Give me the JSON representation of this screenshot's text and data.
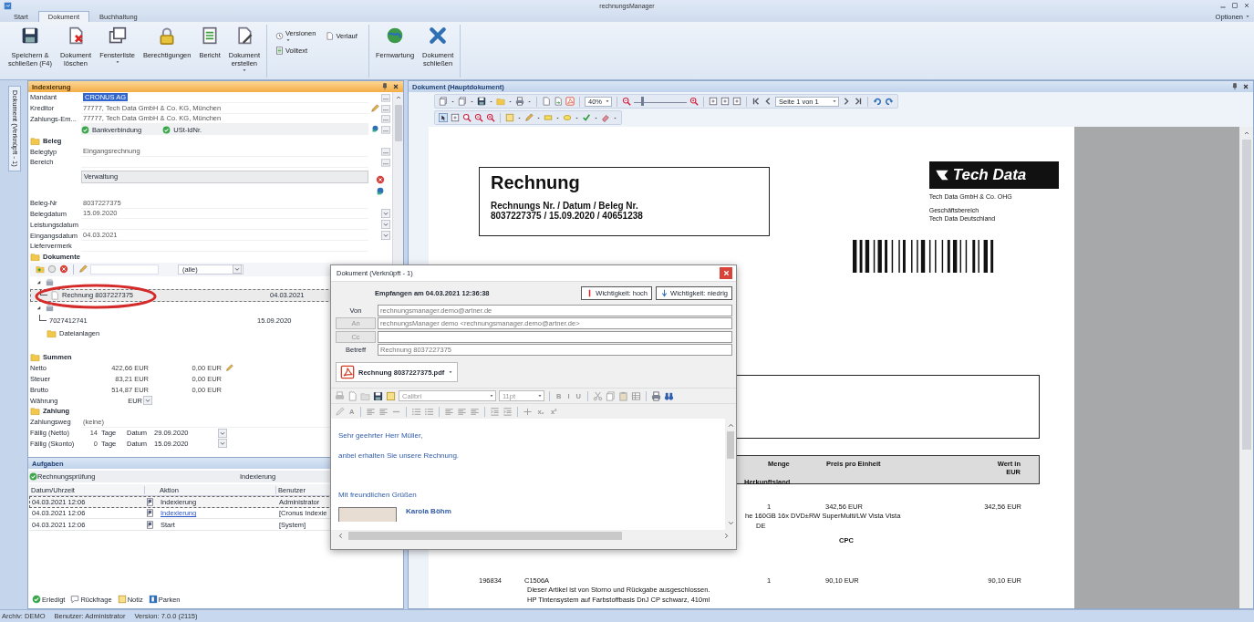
{
  "window": {
    "title": "rechnungsManager"
  },
  "ribbon_tabs": [
    {
      "label": "Start",
      "selected": false
    },
    {
      "label": "Dokument",
      "selected": true
    },
    {
      "label": "Buchhaltung",
      "selected": false
    }
  ],
  "options_menu": {
    "label": "Optionen"
  },
  "ribbon": {
    "groups": [
      {
        "kind": "large",
        "buttons": [
          {
            "label": "Speichern &\nschließen (F4)",
            "dropdown": false
          },
          {
            "label": "Dokument\nlöschen",
            "dropdown": false
          },
          {
            "label": "Fensterliste",
            "dropdown": true
          },
          {
            "label": "Berechtigungen",
            "dropdown": false
          },
          {
            "label": "Bericht",
            "dropdown": false
          },
          {
            "label": "Dokument\nerstellen",
            "dropdown": true
          }
        ]
      },
      {
        "kind": "small",
        "buttons": [
          {
            "label": "Versionen",
            "dropdown": true
          },
          {
            "label": "Verlauf",
            "dropdown": false
          },
          {
            "label": "Volltext",
            "dropdown": false
          }
        ]
      },
      {
        "kind": "large",
        "buttons": [
          {
            "label": "Fernwartung",
            "dropdown": false
          },
          {
            "label": "Dokument\nschließen",
            "dropdown": false
          }
        ]
      }
    ]
  },
  "side_tab": {
    "label": "Dokument (Verknüpft - 1)"
  },
  "indexing": {
    "title": "Indexierung",
    "fields": [
      {
        "kind": "lookup",
        "label": "Mandant",
        "value": "CRONUS AG",
        "highlighted": true
      },
      {
        "kind": "lookup-edit",
        "label": "Kreditor",
        "value": "77777, Tech Data GmbH & Co. KG, München",
        "highlighted": false
      },
      {
        "kind": "lookup",
        "label": "Zahlungs-Em...",
        "value": "77777, Tech Data GmbH & Co. KG, München",
        "highlighted": false
      },
      {
        "kind": "checks",
        "items": [
          {
            "label": "Bankverbindung",
            "checked": true
          },
          {
            "label": "USt-IdNr.",
            "checked": true
          }
        ]
      },
      {
        "kind": "section",
        "label": "Beleg"
      },
      {
        "kind": "lookup",
        "label": "Belegtyp",
        "value": "Eingangsrechnung",
        "highlighted": false
      },
      {
        "kind": "lookup",
        "label": "Bereich",
        "highlighted": false
      },
      {
        "kind": "list",
        "value": "Verwaltung"
      },
      {
        "kind": "text",
        "label": "Beleg-Nr",
        "value": "8037227375",
        "highlighted": false
      },
      {
        "kind": "date",
        "label": "Belegdatum",
        "value": "15.09.2020",
        "highlighted": false
      },
      {
        "kind": "date",
        "label": "Leistungsdatum",
        "highlighted": false
      },
      {
        "kind": "date",
        "label": "Eingangsdatum",
        "value": "04.03.2021",
        "highlighted": false
      },
      {
        "kind": "text",
        "label": "Liefervermerk",
        "highlighted": false
      },
      {
        "kind": "section",
        "label": "Dokumente"
      }
    ],
    "documents": {
      "filter": "(alle)",
      "tree": [
        {
          "kind": "group",
          "expanded": true,
          "children": [
            {
              "kind": "document",
              "label": "Rechnung 8037227375",
              "date": "04.03.2021",
              "selected": true,
              "circled": true
            }
          ]
        },
        {
          "kind": "group",
          "expanded": true,
          "children": [
            {
              "kind": "number",
              "label": "7027412741",
              "date": "15.09.2020",
              "selected": false,
              "circled": false
            }
          ]
        },
        {
          "kind": "folder",
          "label": "Dateianlagen"
        }
      ]
    },
    "sums": {
      "title": "Summen",
      "rows": [
        {
          "kind": "editable",
          "label": "Netto",
          "value": "422,66 EUR",
          "value_2": "0,00 EUR"
        },
        {
          "kind": "plain",
          "label": "Steuer",
          "value": "83,21 EUR",
          "value_2": "0,00 EUR"
        },
        {
          "kind": "plain",
          "label": "Brutto",
          "value": "514,87 EUR",
          "value_2": "0,00 EUR"
        }
      ],
      "currency": {
        "label": "Währung",
        "value": "EUR"
      }
    },
    "payment": {
      "title": "Zahlung",
      "method": {
        "label": "Zahlungsweg",
        "value": "(keine)"
      },
      "due": [
        {
          "label": "Fällig (Netto)",
          "days": "14",
          "unit": "Tage",
          "date_label": "Datum",
          "date": "29.09.2020"
        },
        {
          "label": "Fällig (Skonto)",
          "days": "0",
          "unit": "Tage",
          "date_label": "Datum",
          "date": "15.09.2020"
        }
      ]
    }
  },
  "tasks": {
    "title": "Aufgaben",
    "task": {
      "label": "Rechnungsprüfung",
      "step": "Indexierung"
    },
    "columns": [
      "Datum/Uhrzeit",
      "Aktion",
      "Benutzer"
    ],
    "rows": [
      {
        "time": "04.03.2021 12:06",
        "action": "Indexierung",
        "user": "Administrator",
        "selected": true,
        "link": false
      },
      {
        "time": "04.03.2021 12:06",
        "action": "Indexierung",
        "user": "[Cronus Indexie",
        "selected": false,
        "link": true
      },
      {
        "time": "04.03.2021 12:06",
        "action": "Start",
        "user": "[System]",
        "selected": false,
        "link": false
      }
    ],
    "buttons": [
      "Erledigt",
      "Rückfrage",
      "Notiz",
      "Parken"
    ]
  },
  "document_panel": {
    "title": "Dokument (Hauptdokument)",
    "zoom": "40%",
    "zoom_slider": {
      "level": 0.15
    },
    "page_field": "Seite 1 von 1",
    "page": {
      "heading": "Rechnung",
      "subheading": "Rechnungs Nr. / Datum / Beleg Nr.",
      "reference": "8037227375 / 15.09.2020 / 40651238",
      "logo": "Tech Data",
      "company": "Tech Data GmbH & Co. OHG",
      "division": [
        "Geschäftsbereich",
        "Tech Data Deutschland"
      ],
      "table": {
        "columns": [
          "Menge",
          "Preis pro Einheit",
          "Wert in\nEUR"
        ],
        "subheader": "Herkunftsland",
        "rows": [
          {
            "kind": "partial",
            "quantity": "1",
            "price": "342,56 EUR",
            "total": "342,56 EUR",
            "lines": [
              "he 160GB 16x DVD±RW  SuperMulti/LW Vista Vista",
              "DE"
            ],
            "code": "CPC"
          },
          {
            "kind": "full",
            "number": "196834",
            "article": "C1506A",
            "quantity": "1",
            "price": "90,10 EUR",
            "total": "90,10 EUR",
            "lines": [
              "Dieser Artikel ist von Storno und Rückgabe ausgeschlossen.",
              "HP Tintensystem auf Farbstoffbasis DnJ CP schwarz, 410ml"
            ]
          }
        ]
      }
    }
  },
  "dialog": {
    "title": "Dokument (Verknüpft - 1)",
    "received": "Empfangen am 04.03.2021 12:36:38",
    "priority_buttons": [
      "Wichtigkeit: hoch",
      "Wichtigkeit: niedrig"
    ],
    "fields": [
      {
        "kind": "label",
        "label": "Von",
        "value": "rechnungsmanager.demo@artner.de"
      },
      {
        "kind": "button",
        "label": "An",
        "value": "rechnungsManager demo <rechnungsmanager.demo@artner.de>"
      },
      {
        "kind": "button",
        "label": "Cc"
      },
      {
        "kind": "label",
        "label": "Betreff",
        "value": "Rechnung 8037227375"
      }
    ],
    "attachment": "Rechnung 8037227375.pdf",
    "font": "Calibri",
    "font_size": "11pt",
    "style_buttons": [
      "B",
      "I",
      "U"
    ],
    "color_button": "A",
    "script_buttons": [
      "x₂",
      "x²"
    ],
    "body": [
      "Sehr geehrter Herr Müller,",
      "anbei erhalten Sie unsere Rechnung.",
      "Mit freundlichen Grüßen"
    ],
    "signature": "Karola Böhm"
  },
  "status_bar": [
    "Archiv: DEMO",
    "Benutzer: Administrator",
    "Version: 7.0.0 (2115)"
  ]
}
